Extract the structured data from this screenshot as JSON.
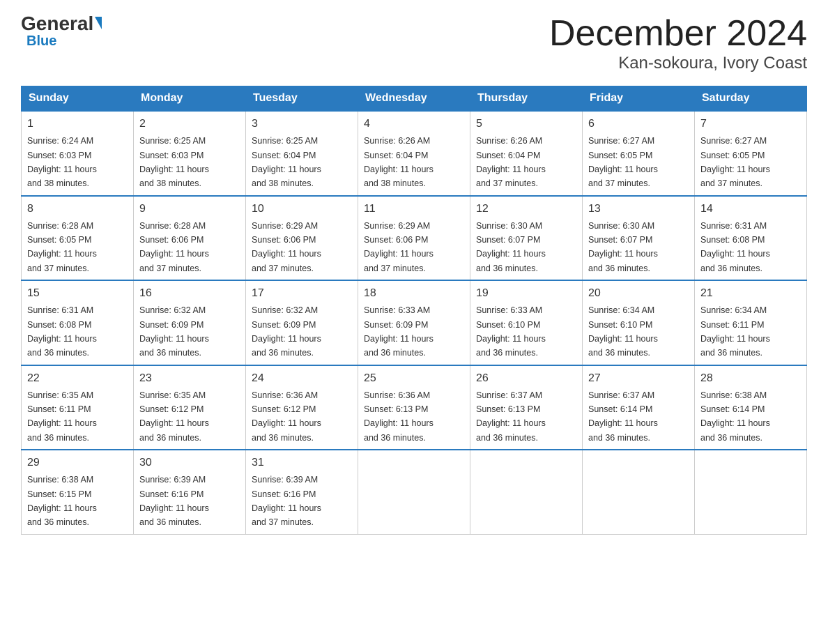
{
  "logo": {
    "general": "General",
    "triangle": "",
    "blue": "Blue"
  },
  "title": "December 2024",
  "subtitle": "Kan-sokoura, Ivory Coast",
  "weekdays": [
    "Sunday",
    "Monday",
    "Tuesday",
    "Wednesday",
    "Thursday",
    "Friday",
    "Saturday"
  ],
  "weeks": [
    [
      {
        "day": "1",
        "sunrise": "6:24 AM",
        "sunset": "6:03 PM",
        "daylight": "11 hours and 38 minutes."
      },
      {
        "day": "2",
        "sunrise": "6:25 AM",
        "sunset": "6:03 PM",
        "daylight": "11 hours and 38 minutes."
      },
      {
        "day": "3",
        "sunrise": "6:25 AM",
        "sunset": "6:04 PM",
        "daylight": "11 hours and 38 minutes."
      },
      {
        "day": "4",
        "sunrise": "6:26 AM",
        "sunset": "6:04 PM",
        "daylight": "11 hours and 38 minutes."
      },
      {
        "day": "5",
        "sunrise": "6:26 AM",
        "sunset": "6:04 PM",
        "daylight": "11 hours and 37 minutes."
      },
      {
        "day": "6",
        "sunrise": "6:27 AM",
        "sunset": "6:05 PM",
        "daylight": "11 hours and 37 minutes."
      },
      {
        "day": "7",
        "sunrise": "6:27 AM",
        "sunset": "6:05 PM",
        "daylight": "11 hours and 37 minutes."
      }
    ],
    [
      {
        "day": "8",
        "sunrise": "6:28 AM",
        "sunset": "6:05 PM",
        "daylight": "11 hours and 37 minutes."
      },
      {
        "day": "9",
        "sunrise": "6:28 AM",
        "sunset": "6:06 PM",
        "daylight": "11 hours and 37 minutes."
      },
      {
        "day": "10",
        "sunrise": "6:29 AM",
        "sunset": "6:06 PM",
        "daylight": "11 hours and 37 minutes."
      },
      {
        "day": "11",
        "sunrise": "6:29 AM",
        "sunset": "6:06 PM",
        "daylight": "11 hours and 37 minutes."
      },
      {
        "day": "12",
        "sunrise": "6:30 AM",
        "sunset": "6:07 PM",
        "daylight": "11 hours and 36 minutes."
      },
      {
        "day": "13",
        "sunrise": "6:30 AM",
        "sunset": "6:07 PM",
        "daylight": "11 hours and 36 minutes."
      },
      {
        "day": "14",
        "sunrise": "6:31 AM",
        "sunset": "6:08 PM",
        "daylight": "11 hours and 36 minutes."
      }
    ],
    [
      {
        "day": "15",
        "sunrise": "6:31 AM",
        "sunset": "6:08 PM",
        "daylight": "11 hours and 36 minutes."
      },
      {
        "day": "16",
        "sunrise": "6:32 AM",
        "sunset": "6:09 PM",
        "daylight": "11 hours and 36 minutes."
      },
      {
        "day": "17",
        "sunrise": "6:32 AM",
        "sunset": "6:09 PM",
        "daylight": "11 hours and 36 minutes."
      },
      {
        "day": "18",
        "sunrise": "6:33 AM",
        "sunset": "6:09 PM",
        "daylight": "11 hours and 36 minutes."
      },
      {
        "day": "19",
        "sunrise": "6:33 AM",
        "sunset": "6:10 PM",
        "daylight": "11 hours and 36 minutes."
      },
      {
        "day": "20",
        "sunrise": "6:34 AM",
        "sunset": "6:10 PM",
        "daylight": "11 hours and 36 minutes."
      },
      {
        "day": "21",
        "sunrise": "6:34 AM",
        "sunset": "6:11 PM",
        "daylight": "11 hours and 36 minutes."
      }
    ],
    [
      {
        "day": "22",
        "sunrise": "6:35 AM",
        "sunset": "6:11 PM",
        "daylight": "11 hours and 36 minutes."
      },
      {
        "day": "23",
        "sunrise": "6:35 AM",
        "sunset": "6:12 PM",
        "daylight": "11 hours and 36 minutes."
      },
      {
        "day": "24",
        "sunrise": "6:36 AM",
        "sunset": "6:12 PM",
        "daylight": "11 hours and 36 minutes."
      },
      {
        "day": "25",
        "sunrise": "6:36 AM",
        "sunset": "6:13 PM",
        "daylight": "11 hours and 36 minutes."
      },
      {
        "day": "26",
        "sunrise": "6:37 AM",
        "sunset": "6:13 PM",
        "daylight": "11 hours and 36 minutes."
      },
      {
        "day": "27",
        "sunrise": "6:37 AM",
        "sunset": "6:14 PM",
        "daylight": "11 hours and 36 minutes."
      },
      {
        "day": "28",
        "sunrise": "6:38 AM",
        "sunset": "6:14 PM",
        "daylight": "11 hours and 36 minutes."
      }
    ],
    [
      {
        "day": "29",
        "sunrise": "6:38 AM",
        "sunset": "6:15 PM",
        "daylight": "11 hours and 36 minutes."
      },
      {
        "day": "30",
        "sunrise": "6:39 AM",
        "sunset": "6:16 PM",
        "daylight": "11 hours and 36 minutes."
      },
      {
        "day": "31",
        "sunrise": "6:39 AM",
        "sunset": "6:16 PM",
        "daylight": "11 hours and 37 minutes."
      },
      null,
      null,
      null,
      null
    ]
  ],
  "labels": {
    "sunrise": "Sunrise:",
    "sunset": "Sunset:",
    "daylight": "Daylight:"
  }
}
